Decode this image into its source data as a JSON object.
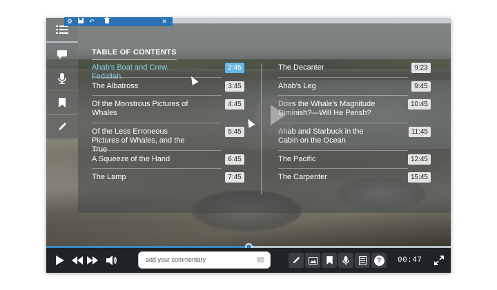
{
  "toc": {
    "title": "TABLE OF CONTENTS",
    "left_items": [
      {
        "label": "Ahab's Boat and Crew. Fedallah.",
        "time": "2:45",
        "active": true
      },
      {
        "label": "The Albatross",
        "time": "3:45"
      },
      {
        "label": "Of the Monstrous Pictures of Whales",
        "time": "4:45"
      },
      {
        "label": "Of the Less Erroneous Pictures of Whales, and the True",
        "time": "5:45"
      },
      {
        "label": "A Squeeze of the Hand",
        "time": "6:45"
      },
      {
        "label": "The Lamp",
        "time": "7:45"
      }
    ],
    "right_items": [
      {
        "label": "The Decanter",
        "time": "9:23"
      },
      {
        "label": "Ahab's Leg",
        "time": "9:45"
      },
      {
        "label": "Does the Whale's Magnitude Diminish?—Will He Perish?",
        "time": "10:45"
      },
      {
        "label": "Ahab and Starbuck in the Cabin on the Ocean",
        "time": "11:45"
      },
      {
        "label": "The Pacific",
        "time": "12:45"
      },
      {
        "label": "The Carpenter",
        "time": "15:45"
      }
    ]
  },
  "edit_toolbar": {
    "icons": [
      "gear-icon",
      "save-icon",
      "undo-icon",
      "trash-icon",
      "close-icon"
    ]
  },
  "rail": {
    "icons": [
      "list-icon",
      "comment-icon",
      "microphone-icon",
      "bookmark-icon",
      "pencil-icon"
    ]
  },
  "player": {
    "progress": 0.5,
    "commentary_placeholder": "add your commentary",
    "time": "00:47",
    "tools": [
      "pencil-icon",
      "image-icon",
      "bookmark-icon",
      "microphone-icon",
      "document-icon",
      "help-icon"
    ],
    "help_label": "?"
  },
  "colors": {
    "accent": "#2f7cc0",
    "active_time_bg": "#66b7e6",
    "controls_bg": "#1f2326"
  }
}
